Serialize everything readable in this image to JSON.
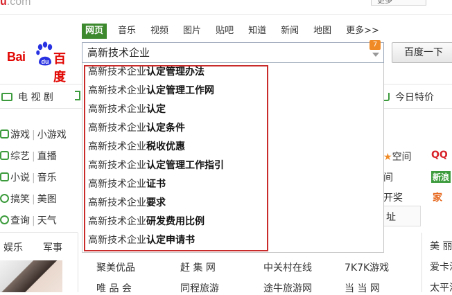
{
  "top": {
    "logo_fragment": "u",
    "logo_fragment_grey": ".com",
    "more_button": "更多"
  },
  "search_tabs": [
    {
      "label": "网页",
      "active": true
    },
    {
      "label": "音乐"
    },
    {
      "label": "视频"
    },
    {
      "label": "图片"
    },
    {
      "label": "贴吧"
    },
    {
      "label": "知道"
    },
    {
      "label": "新闻"
    },
    {
      "label": "地图"
    },
    {
      "label": "更多>>"
    }
  ],
  "logo": {
    "left": "Bai",
    "right": "百度",
    "paw_text": "du"
  },
  "search": {
    "query": "高新技术企业",
    "badge": "7",
    "button": "百度一下"
  },
  "suggestions": [
    {
      "prefix": "高新技术企业",
      "suffix": "认定管理办法"
    },
    {
      "prefix": "高新技术企业",
      "suffix": "认定管理工作网"
    },
    {
      "prefix": "高新技术企业",
      "suffix": "认定"
    },
    {
      "prefix": "高新技术企业",
      "suffix": "认定条件"
    },
    {
      "prefix": "高新技术企业",
      "suffix": "税收优惠"
    },
    {
      "prefix": "高新技术企业",
      "suffix": "认定管理工作指引"
    },
    {
      "prefix": "高新技术企业",
      "suffix": "证书"
    },
    {
      "prefix": "高新技术企业",
      "suffix": "要求"
    },
    {
      "prefix": "高新技术企业",
      "suffix": "研发费用比例"
    },
    {
      "prefix": "高新技术企业",
      "suffix": "认定申请书"
    }
  ],
  "categories": {
    "tv": "电 视 剧",
    "deals": "今日特价"
  },
  "sidebar": [
    {
      "a": "游戏",
      "b": "小游戏"
    },
    {
      "a": "综艺",
      "b": "直播"
    },
    {
      "a": "小说",
      "b": "音乐"
    },
    {
      "a": "搞笑",
      "b": "美图"
    },
    {
      "a": "查询",
      "b": "天气"
    }
  ],
  "lower_tabs": [
    "娱乐",
    "军事"
  ],
  "right_fragments": {
    "space": "空间",
    "space_icon": "QQ",
    "r2": "间",
    "r2_icon": "新浪",
    "r3": "开奖",
    "r3_icon": "家",
    "r4": "址",
    "beauty": "美 丽",
    "love": "爱卡汽",
    "peace": "太平洋"
  },
  "bottom_links": [
    [
      "聚美优品",
      "赶 集 网",
      "中关村在线",
      "7K7K游戏"
    ],
    [
      "唯 品 会",
      "同程旅游",
      "途牛旅游网",
      "当 当 网"
    ]
  ],
  "colors": {
    "brand_red": "#e10602",
    "tab_green": "#3d8a2e",
    "highlight_border": "#c92b2b",
    "badge_orange": "#f08a24"
  }
}
